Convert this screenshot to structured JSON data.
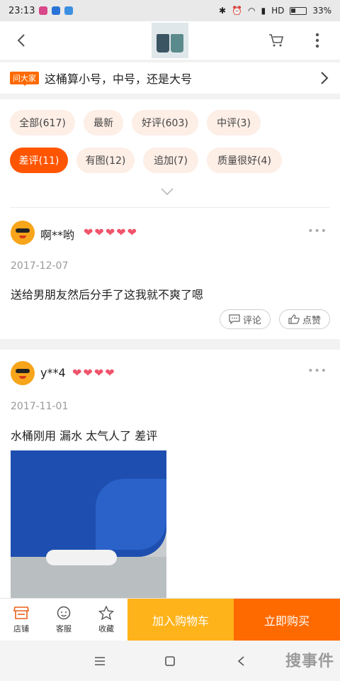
{
  "status_bar": {
    "time": "23:13",
    "network": "HD",
    "battery": "33%"
  },
  "header": {
    "thumbnail_caption": "店铺主图"
  },
  "ask": {
    "badge": "问大家",
    "question": "这桶算小号，中号，还是大号"
  },
  "filters": {
    "chips": [
      {
        "label": "全部(617)",
        "active": false
      },
      {
        "label": "最新",
        "active": false
      },
      {
        "label": "好评(603)",
        "active": false
      },
      {
        "label": "中评(3)",
        "active": false
      },
      {
        "label": "差评(11)",
        "active": true
      },
      {
        "label": "有图(12)",
        "active": false
      },
      {
        "label": "追加(7)",
        "active": false
      },
      {
        "label": "质量很好(4)",
        "active": false
      }
    ]
  },
  "reviews": [
    {
      "user": "啊**哟",
      "hearts": 5,
      "date": "2017-12-07",
      "text": "送给男朋友然后分手了这我就不爽了嗯",
      "comment_label": "评论",
      "like_label": "点赞"
    },
    {
      "user": "y**4",
      "hearts": 4,
      "date": "2017-11-01",
      "text": "水桶刚用 漏水  太气人了  差评"
    }
  ],
  "bottom_bar": {
    "store": "店铺",
    "service": "客服",
    "favorite": "收藏",
    "add_to_cart": "加入购物车",
    "buy_now": "立即购买"
  },
  "watermark": "搜事件",
  "colors": {
    "accent": "#ff5500",
    "cart_button": "#ffb31a",
    "buy_button": "#ff6a00",
    "chip_bg": "#fdeee6",
    "heart": "#f0546b"
  }
}
